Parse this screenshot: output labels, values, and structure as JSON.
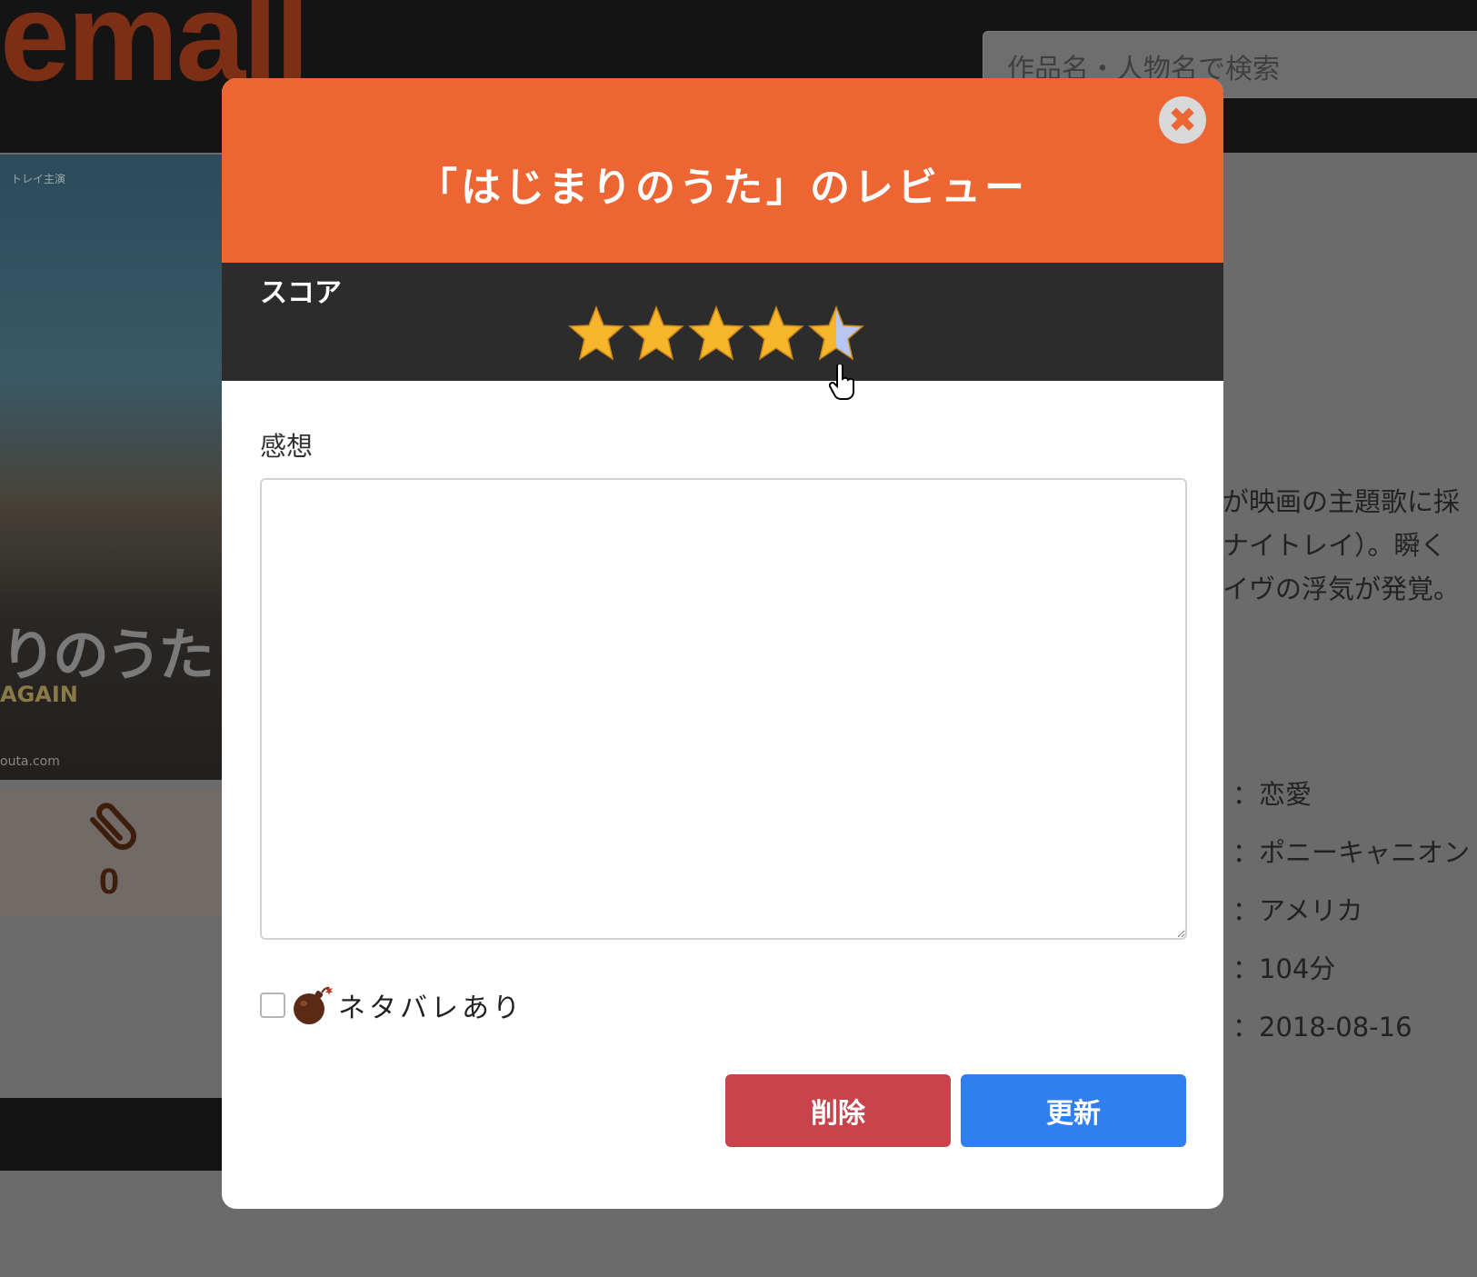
{
  "background": {
    "logo_text": "emall",
    "search_placeholder": "作品名・人物名で検索",
    "poster": {
      "title_text": "りのうた",
      "sub_text": "AGAIN",
      "url_text": "outa.com",
      "caption_text": "トレイ主演"
    },
    "clip_count": "0",
    "description_lines": [
      "が映画の主題歌に採",
      "ナイトレイ）。瞬く",
      "イヴの浮気が発覚。"
    ],
    "meta": {
      "genre": "：恋愛",
      "distributor": "：ポニーキャニオン",
      "country": "：アメリカ",
      "runtime": "：104分",
      "release_date": "：2018-08-16"
    }
  },
  "modal": {
    "title": "「はじまりのうた」のレビュー",
    "close_symbol": "✖",
    "score_label": "スコア",
    "score_value": 4.5,
    "score_max": 5,
    "impression_label": "感想",
    "impression_value": "",
    "spoiler_label": "ネタバレあり",
    "spoiler_checked": false,
    "delete_button": "削除",
    "update_button": "更新"
  },
  "colors": {
    "header": "#ec6532",
    "score_bar": "#2c2c2c",
    "delete": "#c9434b",
    "update": "#2f7fee",
    "star_gold": "#f6b52a",
    "star_blue": "#b7c6f2"
  },
  "icons": {
    "close": "close-icon",
    "star": "star-icon",
    "bomb": "bomb-icon",
    "clip": "paperclip-icon",
    "cursor": "hand-pointer-icon"
  }
}
